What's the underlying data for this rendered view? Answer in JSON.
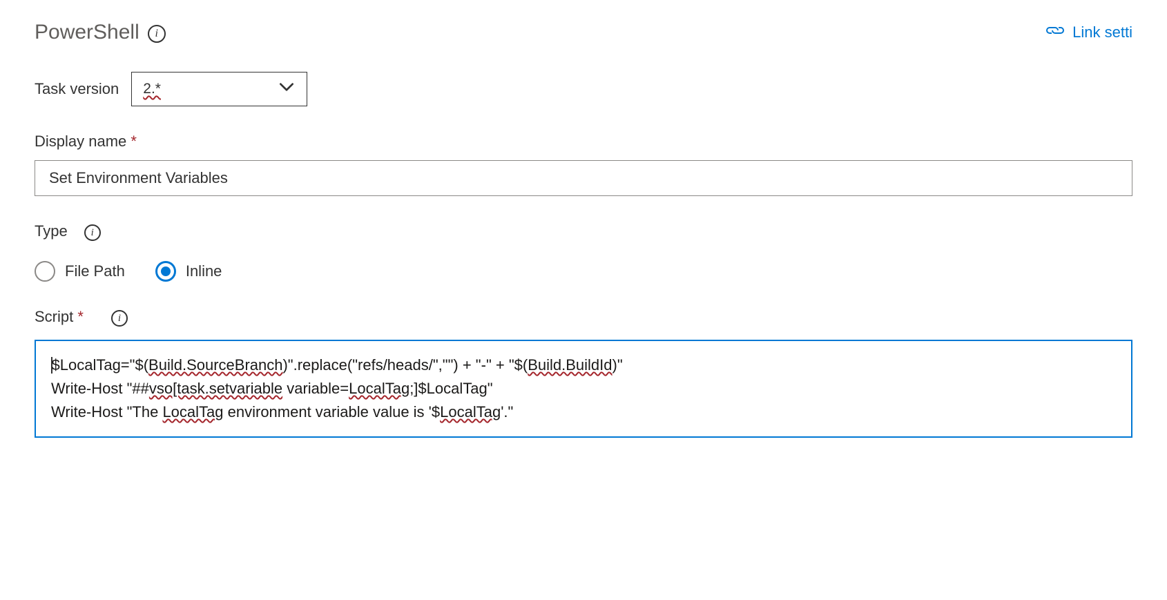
{
  "header": {
    "title": "PowerShell",
    "link_label": "Link setti"
  },
  "task_version": {
    "label": "Task version",
    "value": "2.*"
  },
  "display_name": {
    "label": "Display name",
    "value": "Set Environment Variables"
  },
  "type": {
    "label": "Type",
    "options": {
      "file_path": "File Path",
      "inline": "Inline"
    },
    "selected": "inline"
  },
  "script": {
    "label": "Script",
    "seg1a": "$LocalTag=\"$(",
    "seg1b": "Build.SourceBranch",
    "seg1c": ")\".replace(\"refs/heads/\",\"\") + \"-\" + \"$(",
    "seg1d": "Build.BuildId",
    "seg1e": ")\"",
    "seg2a": "Write-Host \"##",
    "seg2b": "vso[task.setvariable",
    "seg2c": " variable=",
    "seg2d": "LocalTag",
    "seg2e": ";]$LocalTag\"",
    "seg3a": "Write-Host \"The ",
    "seg3b": "LocalTag",
    "seg3c": " environment variable value is '$",
    "seg3d": "LocalTag",
    "seg3e": "'.\""
  }
}
